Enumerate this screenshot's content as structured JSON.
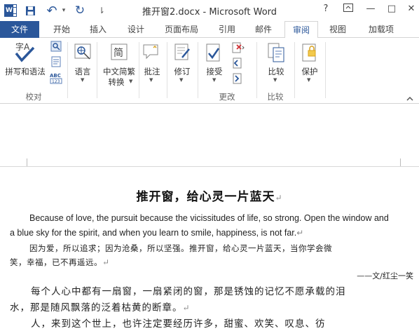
{
  "window": {
    "title": "推开窗2.docx - Microsoft Word",
    "help_label": "?",
    "minimize_label": "—",
    "restore_label": "□",
    "close_label": "✕"
  },
  "quick_access": {
    "undo_label": "↶",
    "redo_label": "↻",
    "dropdown_label": "▾",
    "customize_label": "⇂"
  },
  "tabs": [
    "文件",
    "开始",
    "插入",
    "设计",
    "页面布局",
    "引用",
    "邮件",
    "审阅",
    "视图",
    "加载项"
  ],
  "active_tab": "审阅",
  "ribbon": {
    "proofing": {
      "spell_label": "拼写和语法",
      "group_label": "校对"
    },
    "language_label": "语言",
    "chinese_convert_line1": "中文简繁",
    "chinese_convert_line2": "转换",
    "comments_label": "批注",
    "tracking_label": "修订",
    "accept_label": "接受",
    "changes_group_label": "更改",
    "compare_label": "比较",
    "compare_group_label": "比较",
    "protect_label": "保护"
  },
  "document": {
    "title": "推开窗，给心灵一片蓝天",
    "para_mark": "↵",
    "english_line1": "Because of love, the pursuit because the vicissitudes of life, so strong. Open the window and",
    "english_line2": "a blue sky for the spirit, and when you learn to smile, happiness, is not far.",
    "chinese_line1": "因为爱，所以追求；因为沧桑，所以坚强。推开窗，给心灵一片蓝天，当你学会微",
    "chinese_line2": "笑，幸福，已不再遥远。",
    "signature": "——文/红尘一笑",
    "body_line1": "每个人心中都有一扇窗，一扇紧闭的窗，那是锈蚀的记忆不愿承载的泪",
    "body_line2": "水，那是随风飘落的泛着枯黄的断章。",
    "body_line3": "人，来到这个世上，也许注定要经历许多，甜蜜、欢笑、叹息、彷"
  },
  "colors": {
    "accent": "#2b579a"
  }
}
